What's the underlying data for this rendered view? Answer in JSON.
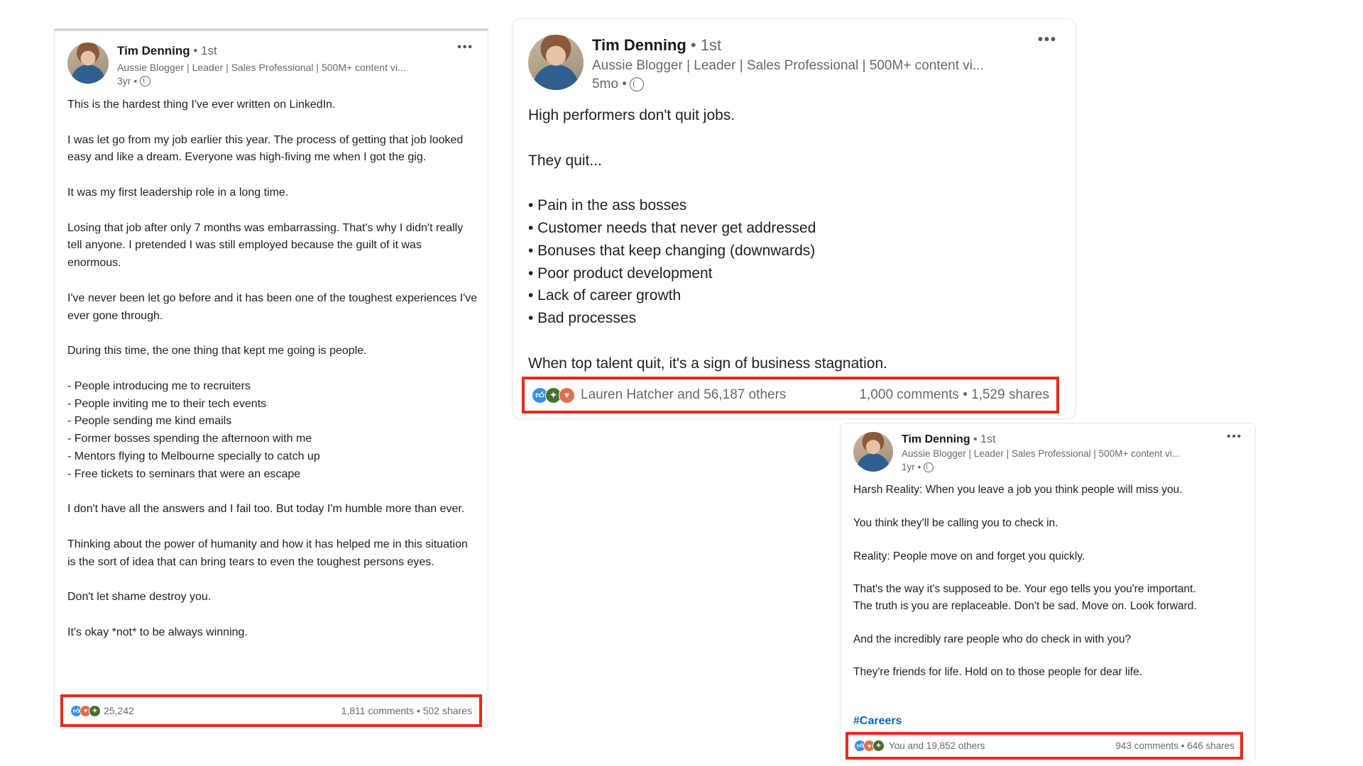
{
  "posts": [
    {
      "author": "Tim Denning",
      "degree": "• 1st",
      "headline": "Aussie Blogger | Leader | Sales Professional | 500M+ content vi...",
      "time": "3yr •",
      "body": "This is the hardest thing I've ever written on LinkedIn.\n\nI was let go from my job earlier this year. The process of getting that job looked easy and like a dream. Everyone was high-fiving me when I got the gig.\n\nIt was my first leadership role in a long time.\n\nLosing that job after only 7 months was embarrassing. That's why I didn't really tell anyone. I pretended I was still employed because the guilt of it was enormous.\n\nI've never been let go before and it has been one of the toughest experiences I've ever gone through.\n\nDuring this time, the one thing that kept me going is people.\n\n- People introducing me to recruiters\n- People inviting me to their tech events\n- People sending me kind emails\n- Former bosses spending the afternoon with me\n- Mentors flying to Melbourne specially to catch up\n- Free tickets to seminars that were an escape\n\nI don't have all the answers and I fail too. But today I'm humble more than ever.\n\nThinking about the power of humanity and how it has helped me in this situation is the sort of idea that can bring tears to even the toughest persons eyes.\n\nDon't let shame destroy you.\n\nIt's okay *not* to be always winning.",
      "reactions_text": "25,242",
      "stats": "1,811 comments • 502 shares",
      "reaction_icons": [
        "like-icon",
        "love-icon",
        "celebrate-icon"
      ]
    },
    {
      "author": "Tim Denning",
      "degree": "• 1st",
      "headline": "Aussie Blogger | Leader | Sales Professional | 500M+ content vi...",
      "time": "5mo •",
      "body": "High performers don't quit jobs.\n\nThey quit...\n\n• Pain in the ass bosses\n• Customer needs that never get addressed\n• Bonuses that keep changing (downwards)\n• Poor product development\n• Lack of career growth\n• Bad processes\n\nWhen top talent quit, it's a sign of business stagnation.",
      "reactions_text": "Lauren Hatcher and 56,187 others",
      "stats": "1,000 comments • 1,529 shares",
      "reaction_icons": [
        "like-icon",
        "celebrate-icon",
        "love-icon"
      ]
    },
    {
      "author": "Tim Denning",
      "degree": "• 1st",
      "headline": "Aussie Blogger | Leader | Sales Professional | 500M+ content vi...",
      "time": "1yr •",
      "body": "Harsh Reality: When you leave a job you think people will miss you.\n\nYou think they'll be calling you to check in.\n\nReality: People move on and forget you quickly.\n\nThat's the way it's supposed to be. Your ego tells you you're important.\nThe truth is you are replaceable. Don't be sad. Move on. Look forward.\n\nAnd the incredibly rare people who do check in with you?\n\nThey're friends for life. Hold on to those people for dear life.",
      "hashtag": "#Careers",
      "reactions_text": "You and 19,852 others",
      "stats": "943 comments • 646 shares",
      "reaction_icons": [
        "like-icon",
        "love-icon",
        "celebrate-icon"
      ]
    }
  ],
  "more_label": "•••",
  "colors": {
    "highlight": "#e8291b",
    "link": "#0a66c2"
  }
}
